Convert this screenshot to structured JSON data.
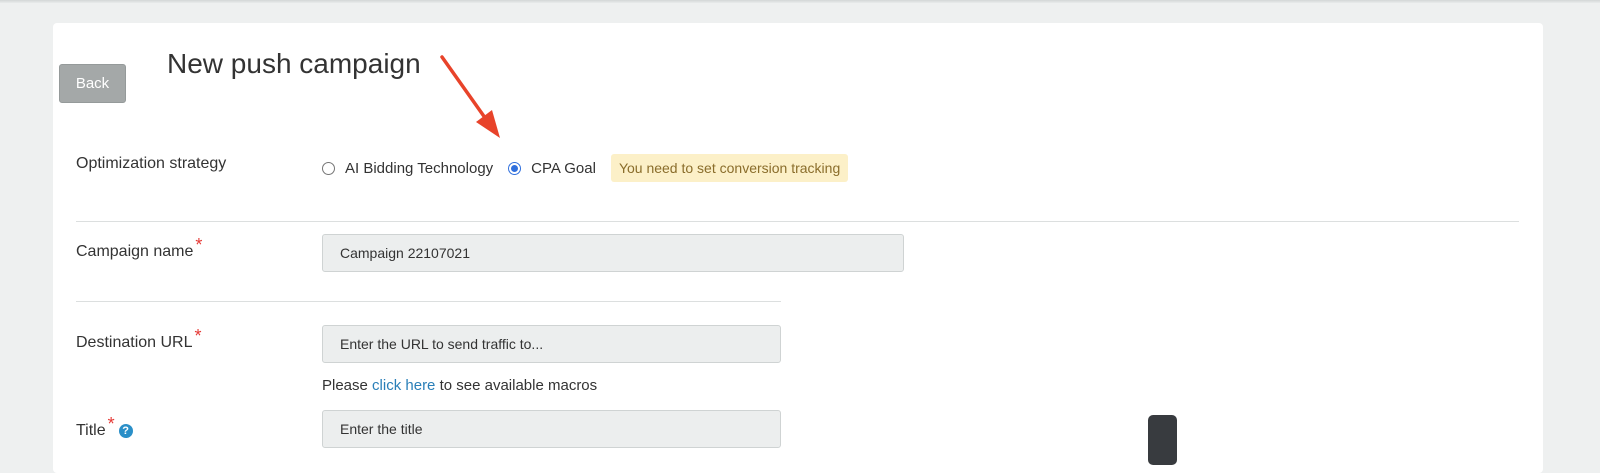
{
  "header": {
    "back_label": "Back",
    "title": "New push campaign"
  },
  "optimization": {
    "label": "Optimization strategy",
    "options": [
      {
        "label": "AI Bidding Technology",
        "selected": false
      },
      {
        "label": "CPA Goal",
        "selected": true
      }
    ],
    "warning": "You need to set conversion tracking"
  },
  "campaign_name": {
    "label": "Campaign name",
    "required_mark": "*",
    "value": "Campaign 22107021"
  },
  "destination_url": {
    "label": "Destination URL",
    "required_mark": "*",
    "placeholder": "Enter the URL to send traffic to...",
    "note_prefix": "Please ",
    "note_link": "click here",
    "note_suffix": " to see available macros"
  },
  "title_field": {
    "label": "Title",
    "required_mark": "*",
    "help_icon": "?",
    "placeholder": "Enter the title"
  },
  "colors": {
    "arrow": "#e8432a",
    "accent": "#2f6fdd",
    "link": "#2a7fb8",
    "required": "#e53935"
  }
}
